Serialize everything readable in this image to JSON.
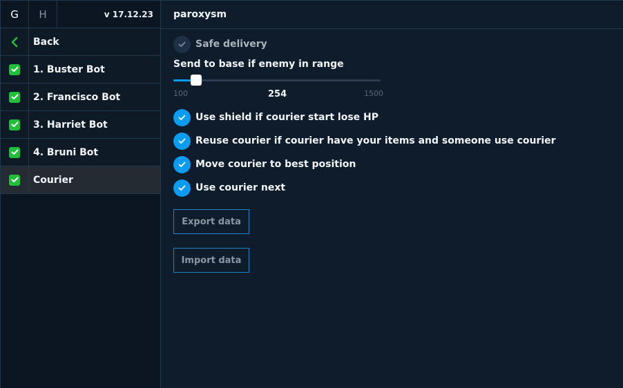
{
  "sidebar": {
    "tabs": [
      {
        "label": "G"
      },
      {
        "label": "H"
      }
    ],
    "version": "v 17.12.23",
    "back_label": "Back",
    "items": [
      {
        "label": "1. Buster Bot",
        "checked": true
      },
      {
        "label": "2. Francisco Bot",
        "checked": true
      },
      {
        "label": "3. Harriet Bot",
        "checked": true
      },
      {
        "label": "4. Bruni Bot",
        "checked": true
      },
      {
        "label": "Courier",
        "checked": true,
        "active": true
      }
    ]
  },
  "main": {
    "title": "paroxysm",
    "safe_delivery": {
      "label": "Safe delivery",
      "enabled": false
    },
    "slider": {
      "label": "Send to base if enemy in range",
      "min": "100",
      "max": "1500",
      "value": "254"
    },
    "options": [
      {
        "label": "Use shield if courier start lose HP",
        "enabled": true
      },
      {
        "label": "Reuse courier if courier have your items and someone use courier",
        "enabled": true
      },
      {
        "label": "Move courier to best position",
        "enabled": true
      },
      {
        "label": "Use courier next",
        "enabled": true
      }
    ],
    "export_label": "Export data",
    "import_label": "Import data"
  },
  "colors": {
    "accent": "#0a9cf0",
    "check_green": "#1fbf3a",
    "background": "#0f1c2b",
    "sidebar_bg": "#0b1622",
    "active_item_bg": "#252b33",
    "border": "#24384c"
  }
}
